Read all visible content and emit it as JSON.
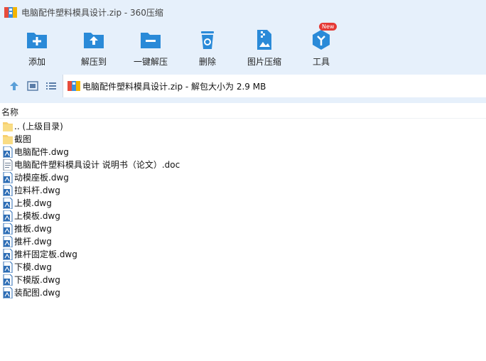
{
  "window": {
    "title": "电脑配件塑料模具设计.zip - 360压缩"
  },
  "toolbar": {
    "items": [
      {
        "label": "添加",
        "icon": "add-icon"
      },
      {
        "label": "解压到",
        "icon": "extract-to-icon"
      },
      {
        "label": "一键解压",
        "icon": "one-click-extract-icon"
      },
      {
        "label": "删除",
        "icon": "delete-icon"
      },
      {
        "label": "图片压缩",
        "icon": "image-compress-icon"
      },
      {
        "label": "工具",
        "icon": "tools-icon",
        "badge": "New"
      }
    ]
  },
  "nav": {
    "buttons": [
      "up-arrow-icon",
      "thumbnail-view-icon",
      "list-view-icon"
    ],
    "path": "电脑配件塑料模具设计.zip - 解包大小为 2.9 MB"
  },
  "columns": {
    "name": "名称"
  },
  "files": [
    {
      "name": ".. (上级目录)",
      "type": "folder"
    },
    {
      "name": "截图",
      "type": "folder"
    },
    {
      "name": "电脑配件.dwg",
      "type": "dwg"
    },
    {
      "name": "电脑配件塑料模具设计 说明书（论文）.doc",
      "type": "doc"
    },
    {
      "name": "动模座板.dwg",
      "type": "dwg"
    },
    {
      "name": "拉料杆.dwg",
      "type": "dwg"
    },
    {
      "name": "上模.dwg",
      "type": "dwg"
    },
    {
      "name": "上模板.dwg",
      "type": "dwg"
    },
    {
      "name": "推板.dwg",
      "type": "dwg"
    },
    {
      "name": "推杆.dwg",
      "type": "dwg"
    },
    {
      "name": "推杆固定板.dwg",
      "type": "dwg"
    },
    {
      "name": "下模.dwg",
      "type": "dwg"
    },
    {
      "name": "下模版.dwg",
      "type": "dwg"
    },
    {
      "name": "装配图.dwg",
      "type": "dwg"
    }
  ],
  "colors": {
    "toolbar_bg": "#e6f0fb",
    "icon_blue": "#2a8ad8",
    "folder_yellow": "#f7d070",
    "badge_red": "#e53935"
  }
}
